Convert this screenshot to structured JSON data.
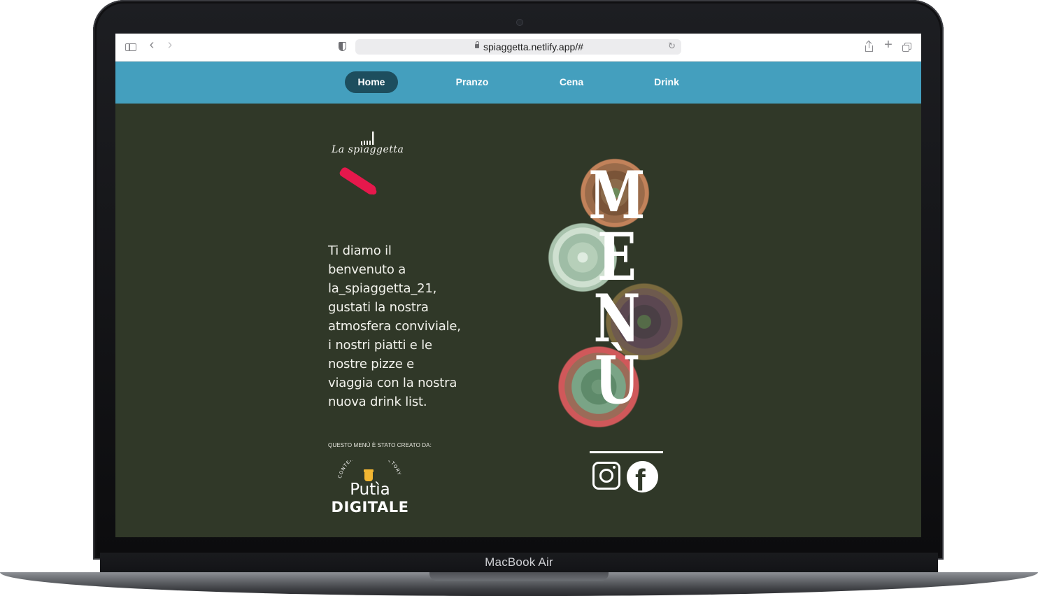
{
  "device": {
    "label": "MacBook Air"
  },
  "browser": {
    "url": "spiaggetta.netlify.app/#"
  },
  "nav": {
    "items": [
      {
        "label": "Home",
        "active": true
      },
      {
        "label": "Pranzo",
        "active": false
      },
      {
        "label": "Cena",
        "active": false
      },
      {
        "label": "Drink",
        "active": false
      }
    ]
  },
  "brand": {
    "logo_text": "La spiaggetta"
  },
  "intro": {
    "text": "Ti diamo il benvenuto a la_spiaggetta_21, gustati la nostra atmosfera conviviale, i nostri piatti e le nostre pizze e viaggia con la nostra nuova drink list."
  },
  "credit": {
    "label": "QUESTO MENÙ È STATO CREATO DA:",
    "arc_text": "CONTENT DESIGN FACTORY",
    "brand_top": "Putìa",
    "brand_bottom": "DIGITALE"
  },
  "menu_art": {
    "letters": [
      "M",
      "E",
      "N",
      "Ù"
    ]
  },
  "social": {
    "icons": [
      "instagram-icon",
      "facebook-icon"
    ]
  },
  "colors": {
    "nav_bg": "#449fbe",
    "nav_active": "#1d4e5e",
    "page_bg": "#303828",
    "accent_stroke": "#e6184c",
    "jar": "#f2b632"
  }
}
